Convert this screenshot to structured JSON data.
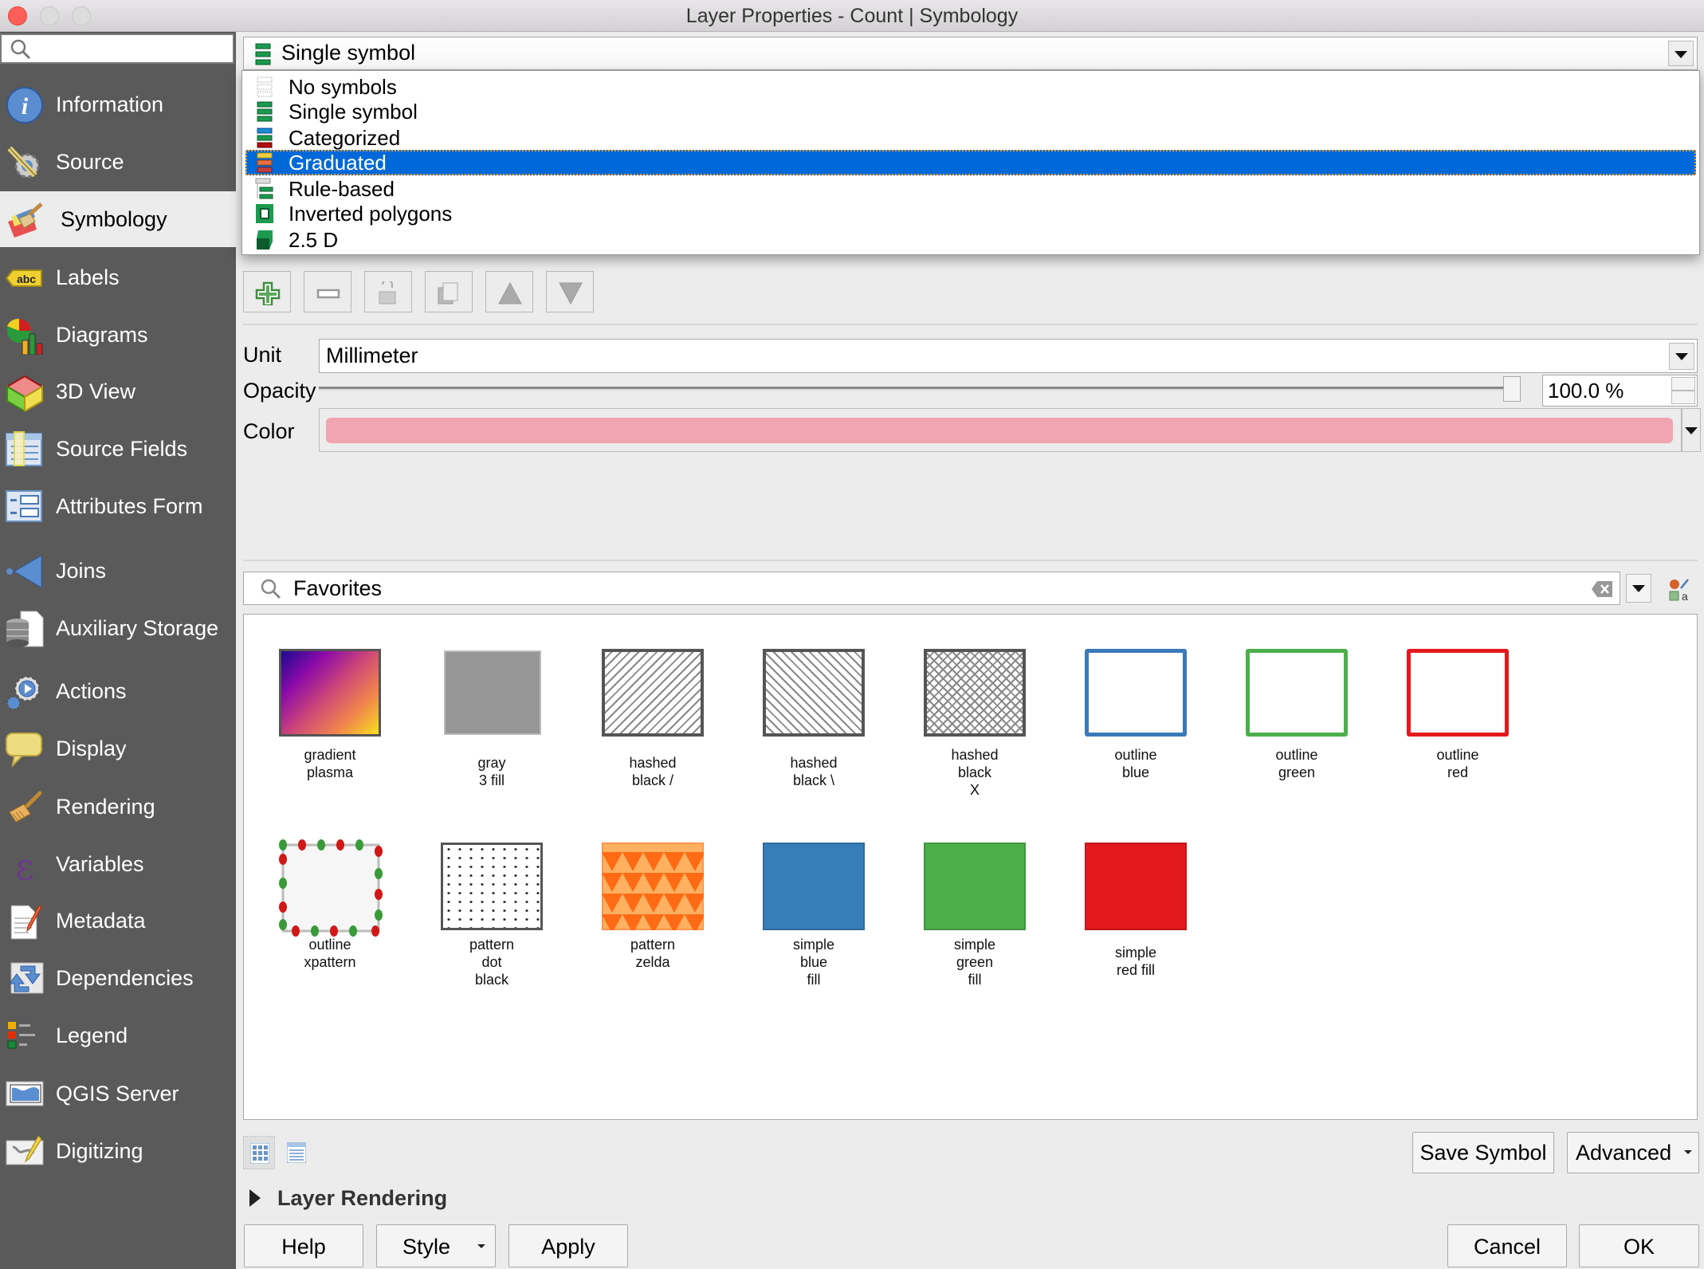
{
  "window": {
    "title": "Layer Properties - Count | Symbology"
  },
  "sidebar": {
    "search_placeholder": "",
    "items": [
      {
        "label": "Information",
        "icon": "info-icon"
      },
      {
        "label": "Source",
        "icon": "source-wrench-icon"
      },
      {
        "label": "Symbology",
        "icon": "paintbrush-icon",
        "selected": true
      },
      {
        "label": "Labels",
        "icon": "labels-abc-icon"
      },
      {
        "label": "Diagrams",
        "icon": "diagrams-chart-icon"
      },
      {
        "label": "3D View",
        "icon": "cube-icon"
      },
      {
        "label": "Source Fields",
        "icon": "table-fields-icon"
      },
      {
        "label": "Attributes Form",
        "icon": "form-icon"
      },
      {
        "label": "Joins",
        "icon": "joins-icon"
      },
      {
        "label": "Auxiliary Storage",
        "icon": "database-icon"
      },
      {
        "label": "Actions",
        "icon": "gear-play-icon"
      },
      {
        "label": "Display",
        "icon": "speech-bubble-icon"
      },
      {
        "label": "Rendering",
        "icon": "brush-icon"
      },
      {
        "label": "Variables",
        "icon": "epsilon-icon"
      },
      {
        "label": "Metadata",
        "icon": "document-pencil-icon"
      },
      {
        "label": "Dependencies",
        "icon": "dependencies-arrows-icon"
      },
      {
        "label": "Legend",
        "icon": "legend-icon"
      },
      {
        "label": "QGIS Server",
        "icon": "map-server-icon"
      },
      {
        "label": "Digitizing",
        "icon": "map-pencil-icon"
      }
    ]
  },
  "renderer": {
    "selected": "Single symbol",
    "options": [
      {
        "label": "No symbols",
        "icon": "no-symbols-icon"
      },
      {
        "label": "Single symbol",
        "icon": "single-symbol-icon"
      },
      {
        "label": "Categorized",
        "icon": "categorized-icon"
      },
      {
        "label": "Graduated",
        "icon": "graduated-icon",
        "highlighted": true
      },
      {
        "label": "Rule-based",
        "icon": "rule-based-icon"
      },
      {
        "label": "Inverted polygons",
        "icon": "inverted-polygons-icon"
      },
      {
        "label": "2.5 D",
        "icon": "two-point-five-d-icon"
      }
    ]
  },
  "toolbar": [
    "add-symbol-layer",
    "remove-symbol-layer",
    "lock-color",
    "duplicate-layer",
    "move-up",
    "move-down"
  ],
  "form": {
    "unit_label": "Unit",
    "unit_value": "Millimeter",
    "opacity_label": "Opacity",
    "opacity_value": "100.0 %",
    "opacity_percent": 100,
    "color_label": "Color",
    "color_value": "#f2a4b0"
  },
  "library": {
    "search_value": "Favorites",
    "symbols": [
      {
        "label": "gradient\nplasma",
        "kind": "gradient"
      },
      {
        "label": "gray\n3 fill",
        "kind": "gray"
      },
      {
        "label": "hashed\nblack /",
        "kind": "hash-fwd"
      },
      {
        "label": "hashed\nblack \\",
        "kind": "hash-back"
      },
      {
        "label": "hashed\nblack\nX",
        "kind": "hash-x"
      },
      {
        "label": "outline\nblue",
        "kind": "outline",
        "color": "#3a7ab8"
      },
      {
        "label": "outline\ngreen",
        "kind": "outline",
        "color": "#4caf4c"
      },
      {
        "label": "outline\nred",
        "kind": "outline",
        "color": "#e31a1c"
      },
      {
        "label": "outline\nxpattern",
        "kind": "xpattern"
      },
      {
        "label": "pattern\ndot\nblack",
        "kind": "dots"
      },
      {
        "label": "pattern\nzelda",
        "kind": "zelda"
      },
      {
        "label": "simple\nblue\nfill",
        "kind": "fill",
        "color": "#377eb8"
      },
      {
        "label": "simple\ngreen\nfill",
        "kind": "fill",
        "color": "#4daf4a"
      },
      {
        "label": "simple\nred fill",
        "kind": "fill",
        "color": "#e31a1c"
      }
    ]
  },
  "buttons": {
    "save_symbol": "Save Symbol",
    "advanced": "Advanced",
    "layer_rendering": "Layer Rendering",
    "help": "Help",
    "style": "Style",
    "apply": "Apply",
    "cancel": "Cancel",
    "ok": "OK"
  }
}
